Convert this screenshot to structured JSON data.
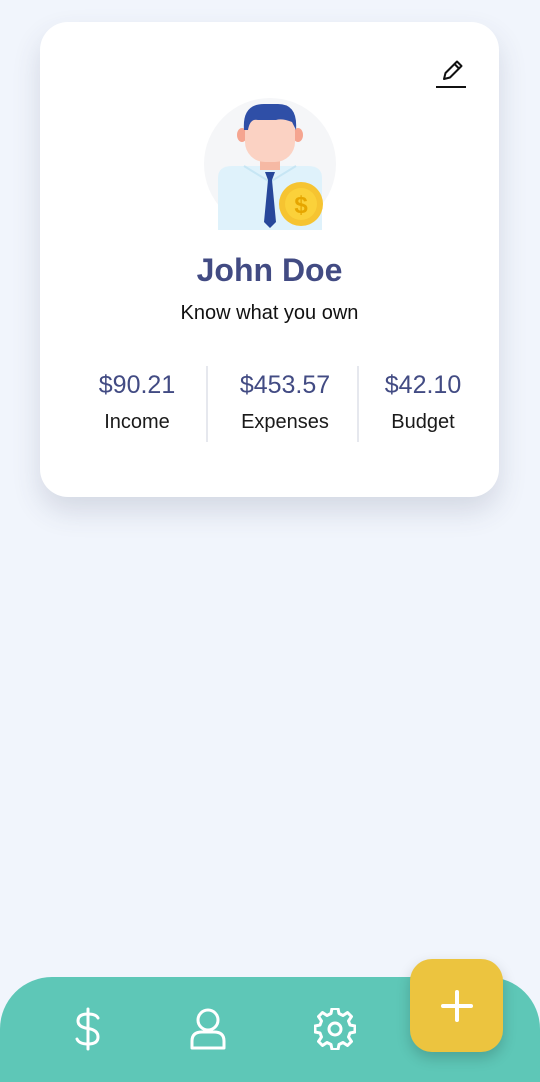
{
  "profile": {
    "name": "John Doe",
    "tagline": "Know what you own"
  },
  "stats": [
    {
      "amount": "$90.21",
      "label": "Income"
    },
    {
      "amount": "$453.57",
      "label": "Expenses"
    },
    {
      "amount": "$42.10",
      "label": "Budget"
    }
  ],
  "icons": {
    "edit": "pencil-icon",
    "avatar": "businessman-with-coin-illustration",
    "nav": [
      "dollar-icon",
      "user-icon",
      "gear-icon"
    ],
    "fab": "plus-icon"
  },
  "colors": {
    "background": "#f1f5fc",
    "card": "#ffffff",
    "accent_text": "#424b83",
    "nav_bar": "#5ec7b7",
    "fab": "#ecc43f"
  }
}
